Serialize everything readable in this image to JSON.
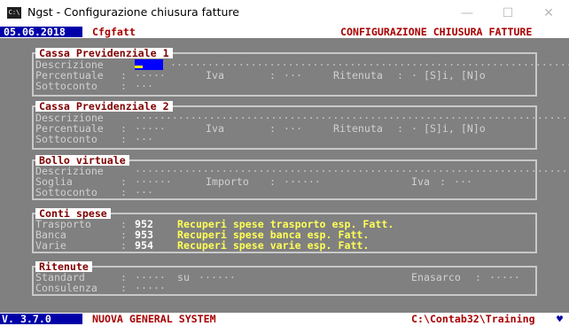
{
  "window": {
    "app_icon": "C:\\",
    "title": "Ngst - Configurazione chiusura fatture",
    "minimize": "—",
    "maximize": "☐",
    "close": "✕"
  },
  "header": {
    "date": "05.06.2018",
    "program": "Cfgfatt",
    "screen_title": "CONFIGURAZIONE CHIUSURA FATTURE"
  },
  "cassa1": {
    "title": "Cassa Previdenziale 1",
    "descrizione_label": "Descrizione",
    "descrizione_dots": "···································································",
    "percentuale_label": "Percentuale",
    "percentuale_dots": "·····",
    "iva_label": "Iva",
    "iva_dots": "···",
    "ritenuta_label": "Ritenuta",
    "ritenuta_value": "· [S]i, [N]o",
    "sottoconto_label": "Sottoconto",
    "sottoconto_dots": "···"
  },
  "cassa2": {
    "title": "Cassa Previdenziale 2",
    "descrizione_label": "Descrizione",
    "descrizione_dots": "········································································",
    "percentuale_label": "Percentuale",
    "percentuale_dots": "·····",
    "iva_label": "Iva",
    "iva_dots": "···",
    "ritenuta_label": "Ritenuta",
    "ritenuta_value": "· [S]i, [N]o",
    "sottoconto_label": "Sottoconto",
    "sottoconto_dots": "···"
  },
  "bollo": {
    "title": "Bollo virtuale",
    "descrizione_label": "Descrizione",
    "descrizione_dots": "········································································",
    "soglia_label": "Soglia",
    "soglia_dots": "······",
    "importo_label": "Importo",
    "importo_dots": "······",
    "iva_label": "Iva",
    "iva_dots": "···",
    "sottoconto_label": "Sottoconto",
    "sottoconto_dots": "···"
  },
  "conti": {
    "title": "Conti spese",
    "rows": [
      {
        "label": "Trasporto",
        "code": "952",
        "desc": "Recuperi spese trasporto esp. Fatt."
      },
      {
        "label": "Banca",
        "code": "953",
        "desc": "Recuperi spese banca esp. Fatt."
      },
      {
        "label": "Varie",
        "code": "954",
        "desc": "Recuperi spese varie esp. Fatt."
      }
    ]
  },
  "ritenute": {
    "title": "Ritenute",
    "standard_label": "Standard",
    "standard_dots": "·····",
    "su_label": "su",
    "su_dots": "······",
    "enasarco_label": "Enasarco",
    "enasarco_dots": "·····",
    "consulenza_label": "Consulenza",
    "consulenza_dots": "·····"
  },
  "footer": {
    "version": "V. 3.7.0",
    "system": "NUOVA GENERAL SYSTEM",
    "path": "C:\\Contab32\\Training"
  },
  "colors": {
    "console_bg": "#808080",
    "header_blue": "#0000a8",
    "title_red": "#a80000",
    "highlight_yellow": "#ffff55"
  }
}
